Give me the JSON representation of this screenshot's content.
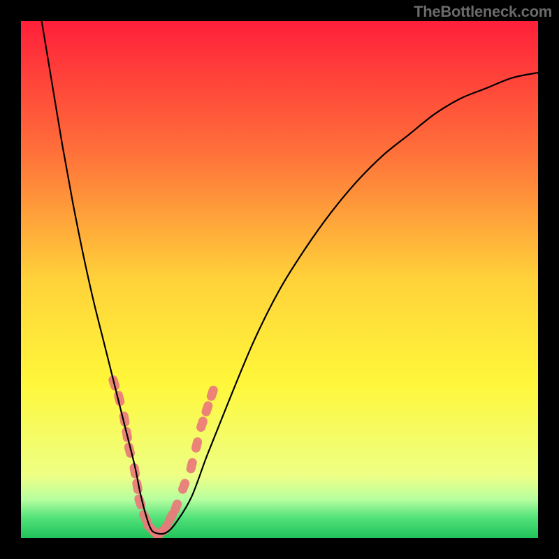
{
  "watermark": "TheBottleneck.com",
  "chart_data": {
    "type": "line",
    "title": "",
    "xlabel": "",
    "ylabel": "",
    "xlim": [
      0,
      100
    ],
    "ylim": [
      0,
      100
    ],
    "grid": false,
    "legend": false,
    "background_gradient": {
      "stops": [
        {
          "pos": 0.0,
          "color": "#ff1f3a"
        },
        {
          "pos": 0.25,
          "color": "#ff6f3a"
        },
        {
          "pos": 0.5,
          "color": "#ffd23a"
        },
        {
          "pos": 0.7,
          "color": "#fff73a"
        },
        {
          "pos": 0.88,
          "color": "#edff85"
        },
        {
          "pos": 0.925,
          "color": "#b8ffa0"
        },
        {
          "pos": 0.96,
          "color": "#54e27a"
        },
        {
          "pos": 1.0,
          "color": "#20c25a"
        }
      ]
    },
    "series": [
      {
        "name": "bottleneck-curve",
        "color": "#000000",
        "x": [
          4,
          6,
          8,
          10,
          12,
          14,
          16,
          18,
          20,
          22,
          23,
          24,
          25,
          26,
          28,
          30,
          33,
          36,
          40,
          45,
          50,
          55,
          60,
          65,
          70,
          75,
          80,
          85,
          90,
          95,
          100
        ],
        "y": [
          100,
          88,
          76,
          65,
          55,
          46,
          38,
          30,
          22,
          14,
          9,
          5,
          2,
          1,
          1,
          3,
          8,
          16,
          26,
          38,
          48,
          56,
          63,
          69,
          74,
          78,
          82,
          85,
          87,
          89,
          90
        ]
      }
    ],
    "marker_clusters": [
      {
        "name": "left-arm-markers",
        "color": "#e97a7a",
        "points": [
          {
            "x": 18,
            "y": 30
          },
          {
            "x": 19,
            "y": 27
          },
          {
            "x": 20,
            "y": 23
          },
          {
            "x": 20.5,
            "y": 20
          },
          {
            "x": 21,
            "y": 17
          },
          {
            "x": 22,
            "y": 13
          },
          {
            "x": 22.5,
            "y": 10
          },
          {
            "x": 23,
            "y": 7
          },
          {
            "x": 24,
            "y": 4
          },
          {
            "x": 25,
            "y": 2
          },
          {
            "x": 26,
            "y": 1
          }
        ]
      },
      {
        "name": "right-arm-markers",
        "color": "#e97a7a",
        "points": [
          {
            "x": 27,
            "y": 1
          },
          {
            "x": 28,
            "y": 2
          },
          {
            "x": 29,
            "y": 4
          },
          {
            "x": 30,
            "y": 6
          },
          {
            "x": 31.5,
            "y": 10
          },
          {
            "x": 33,
            "y": 14
          },
          {
            "x": 34,
            "y": 18
          },
          {
            "x": 35,
            "y": 22
          },
          {
            "x": 36,
            "y": 25
          },
          {
            "x": 37,
            "y": 28
          }
        ]
      }
    ]
  }
}
